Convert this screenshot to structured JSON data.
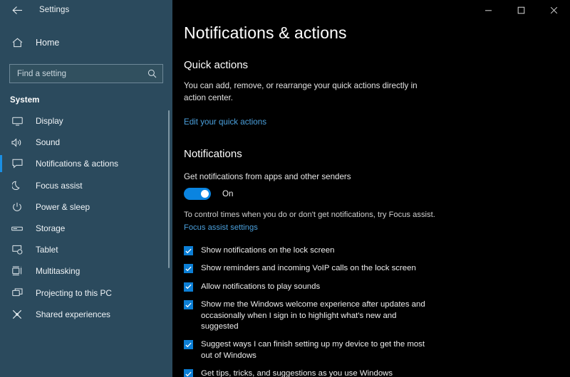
{
  "window": {
    "title": "Settings",
    "back_icon": "back-arrow-icon",
    "controls": {
      "minimize": "minimize-icon",
      "maximize": "maximize-icon",
      "close": "close-icon"
    }
  },
  "sidebar": {
    "home_label": "Home",
    "home_icon": "home-icon",
    "search": {
      "placeholder": "Find a setting",
      "value": "",
      "icon": "search-icon"
    },
    "group_title": "System",
    "accent_color": "#1a8fe3",
    "background_color": "#2b4a5d",
    "items": [
      {
        "label": "Display",
        "icon": "monitor-icon",
        "selected": false
      },
      {
        "label": "Sound",
        "icon": "speaker-icon",
        "selected": false
      },
      {
        "label": "Notifications & actions",
        "icon": "notification-bubble-icon",
        "selected": true
      },
      {
        "label": "Focus assist",
        "icon": "moon-icon",
        "selected": false
      },
      {
        "label": "Power & sleep",
        "icon": "power-icon",
        "selected": false
      },
      {
        "label": "Storage",
        "icon": "storage-icon",
        "selected": false
      },
      {
        "label": "Tablet",
        "icon": "tablet-icon",
        "selected": false
      },
      {
        "label": "Multitasking",
        "icon": "multitasking-icon",
        "selected": false
      },
      {
        "label": "Projecting to this PC",
        "icon": "projecting-icon",
        "selected": false
      },
      {
        "label": "Shared experiences",
        "icon": "shared-experiences-icon",
        "selected": false
      }
    ]
  },
  "main": {
    "page_title": "Notifications & actions",
    "quick_actions": {
      "heading": "Quick actions",
      "description": "You can add, remove, or rearrange your quick actions directly in action center.",
      "link": "Edit your quick actions"
    },
    "notifications": {
      "heading": "Notifications",
      "toggle_label": "Get notifications from apps and other senders",
      "toggle_state": "On",
      "toggle_on": true,
      "toggle_color": "#0a84e0",
      "hint": "To control times when you do or don't get notifications, try Focus assist.",
      "hint_link": "Focus assist settings",
      "link_color": "#4ba0dc",
      "checkboxes": [
        {
          "label": "Show notifications on the lock screen",
          "checked": true
        },
        {
          "label": "Show reminders and incoming VoIP calls on the lock screen",
          "checked": true
        },
        {
          "label": "Allow notifications to play sounds",
          "checked": true
        },
        {
          "label": "Show me the Windows welcome experience after updates and occasionally when I sign in to highlight what's new and suggested",
          "checked": true
        },
        {
          "label": "Suggest ways I can finish setting up my device to get the most out of Windows",
          "checked": true
        },
        {
          "label": "Get tips, tricks, and suggestions as you use Windows",
          "checked": true
        }
      ]
    }
  }
}
